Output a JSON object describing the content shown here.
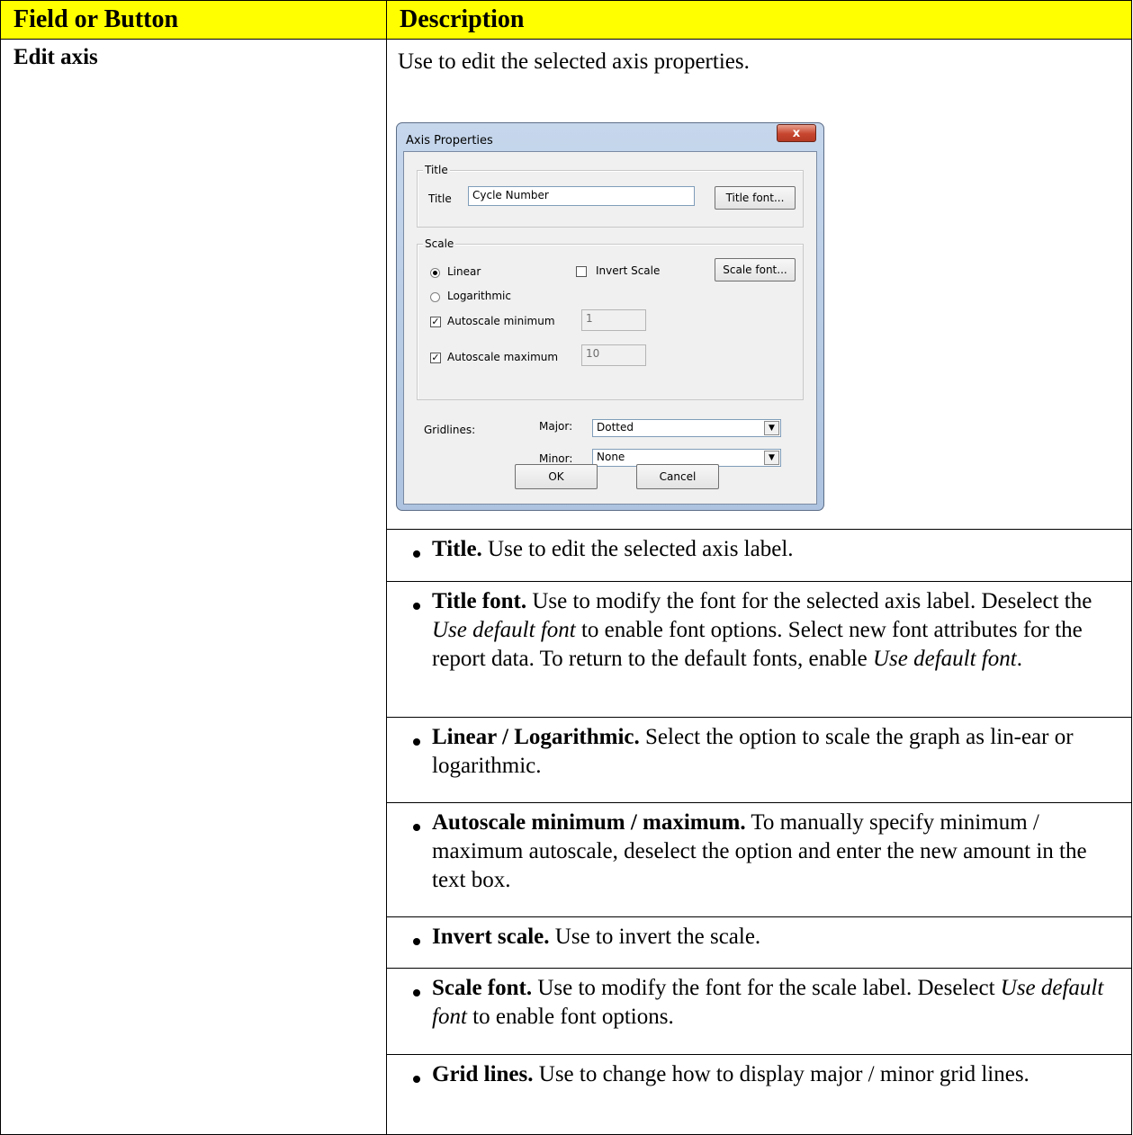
{
  "header": {
    "col1": "Field or Button",
    "col2": "Description"
  },
  "row": {
    "field": "Edit axis",
    "intro": "Use to edit the selected axis properties."
  },
  "dialog": {
    "title": "Axis Properties",
    "close_label": "x",
    "title_group": "Title",
    "title_label": "Title",
    "title_value": "Cycle Number",
    "title_font_button": "Title font...",
    "scale_group": "Scale",
    "linear_label": "Linear",
    "linear_selected": true,
    "logarithmic_label": "Logarithmic",
    "invert_scale_label": "Invert Scale",
    "invert_scale_checked": false,
    "scale_font_button": "Scale font...",
    "autoscale_min_label": "Autoscale minimum",
    "autoscale_min_checked": true,
    "autoscale_min_value": "1",
    "autoscale_max_label": "Autoscale maximum",
    "autoscale_max_checked": true,
    "autoscale_max_value": "10",
    "gridlines_label": "Gridlines:",
    "major_label": "Major:",
    "major_value": "Dotted",
    "minor_label": "Minor:",
    "minor_value": "None",
    "ok_button": "OK",
    "cancel_button": "Cancel"
  },
  "bullets": [
    {
      "term": "Title.",
      "text": " Use to edit the selected axis label."
    },
    {
      "term": "Title font.",
      "text_a": " Use to modify the font for the selected axis label. Deselect the ",
      "em1": "Use default font",
      "text_b": " to enable font options. Select new font attributes for the report data. To return to the default fonts, enable ",
      "em2": "Use default font",
      "text_c": "."
    },
    {
      "term": "Linear / Logarithmic.",
      "text": " Select the option to scale the graph as lin-ear or logarithmic."
    },
    {
      "term": "Autoscale minimum / maximum.",
      "text": " To manually specify minimum / maximum autoscale, deselect the option and enter the new amount in the text box."
    },
    {
      "term": "Invert scale.",
      "text": " Use to invert the scale."
    },
    {
      "term": "Scale font.",
      "text_a": " Use to modify the font for the scale label. Deselect ",
      "em1": "Use default font",
      "text_b": " to enable font options."
    },
    {
      "term": "Grid lines.",
      "text": " Use to change how to display major / minor grid lines."
    }
  ]
}
